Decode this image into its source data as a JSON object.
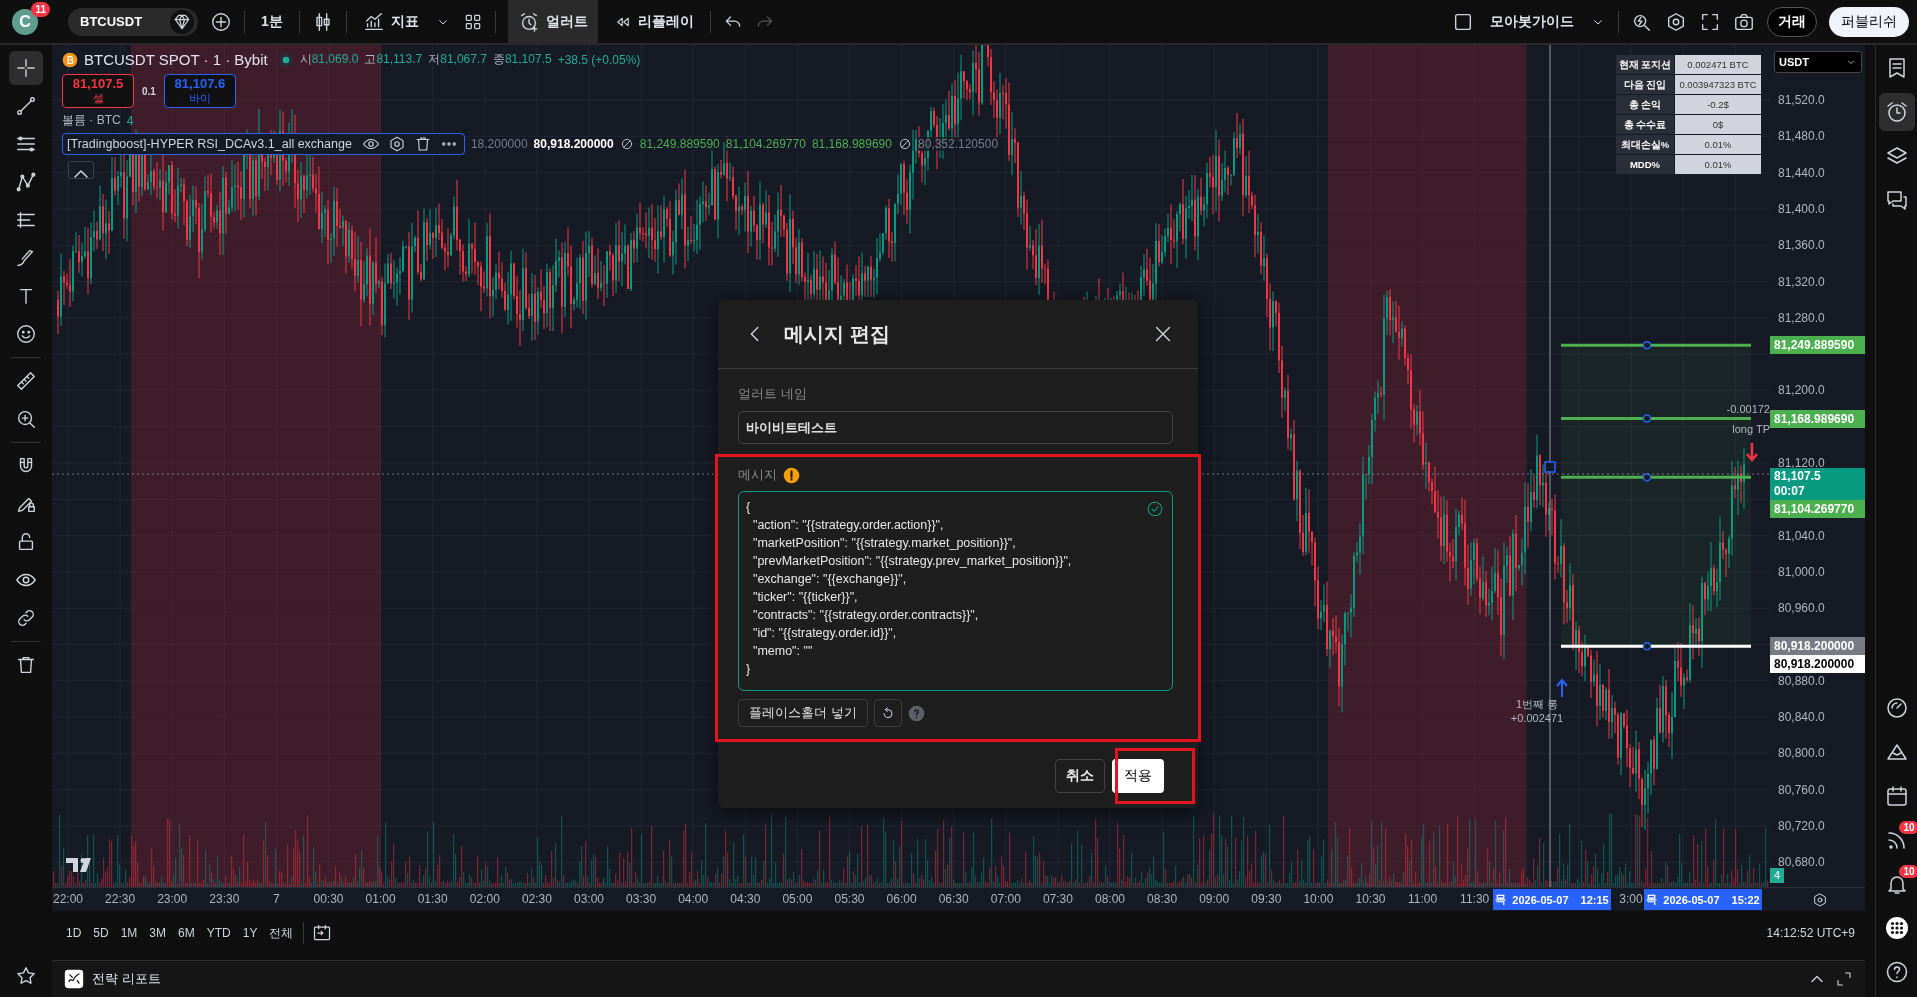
{
  "top_bar": {
    "avatar": "C",
    "avatar_badge": "11",
    "symbol": "BTCUSDT",
    "interval": "1분",
    "indicators": "지표",
    "alert": {
      "label": "얼러트",
      "selected": true
    },
    "replay": "리플레이",
    "layout_name": "모아봇가이드",
    "trade": "거래",
    "publish": "퍼블리쉬"
  },
  "left_toolbar": [
    {
      "kind": "crosshair",
      "selected": true
    },
    {
      "kind": "trendline",
      "selected": false
    },
    {
      "kind": "lines",
      "selected": false
    },
    {
      "kind": "pattern",
      "selected": false
    },
    {
      "kind": "fib",
      "selected": false
    },
    {
      "kind": "brush",
      "selected": false
    },
    {
      "kind": "text",
      "selected": false
    },
    {
      "kind": "emoji",
      "selected": false
    },
    {
      "kind": "ruler",
      "selected": false
    },
    {
      "kind": "zoom",
      "selected": false
    },
    {
      "kind": "magnet",
      "selected": false
    },
    {
      "kind": "pencil-lock",
      "selected": false
    },
    {
      "kind": "lock",
      "selected": false
    },
    {
      "kind": "eye",
      "selected": false
    },
    {
      "kind": "link",
      "selected": false
    },
    {
      "kind": "trash",
      "selected": false
    },
    {
      "kind": "star",
      "selected": false
    }
  ],
  "legend": {
    "title": "BTCUSDT SPOT · 1 · Bybit",
    "ohlc": [
      {
        "label": "시",
        "value": "81,069.0"
      },
      {
        "label": "고",
        "value": "81,113.7"
      },
      {
        "label": "저",
        "value": "81,067.7"
      },
      {
        "label": "종",
        "value": "81,107.5"
      }
    ],
    "change": "+38.5 (+0.05%)",
    "sell_price": "81,107.5",
    "sell_label": "셀",
    "spread": "0.1",
    "buy_price": "81,107.6",
    "buy_label": "바이",
    "volume_label": "볼륨 · BTC",
    "volume_value": "4",
    "strategy_name": "[Tradingboost]-HYPER RSI_DCAv3.1_all exchange",
    "strategy_values": [
      {
        "kind": "value",
        "text": "18.200000",
        "color": "#787b86"
      },
      {
        "kind": "value",
        "text": "80,918.200000",
        "color": "#ffffff"
      },
      {
        "kind": "na"
      },
      {
        "kind": "value",
        "text": "81,249.889590",
        "color": "#4caf50"
      },
      {
        "kind": "value",
        "text": "81,104.269770",
        "color": "#4caf50"
      },
      {
        "kind": "value",
        "text": "81,168.989690",
        "color": "#4caf50"
      },
      {
        "kind": "na"
      },
      {
        "kind": "value",
        "text": "80,352.120500",
        "color": "#787b86"
      }
    ]
  },
  "strategy_table": [
    {
      "label": "현재 포지션",
      "value": "0.002471 BTC"
    },
    {
      "label": "다음 진입",
      "value": "0.003947323 BTC"
    },
    {
      "label": "총 손익",
      "value": "-0.2$"
    },
    {
      "label": "총 수수료",
      "value": "0$"
    },
    {
      "label": "최대손실%",
      "value": "0.01%"
    },
    {
      "label": "MDD%",
      "value": "0.01%"
    }
  ],
  "chart_annotations": [
    {
      "text": "-0.00172"
    },
    {
      "text": "long TP"
    },
    {
      "text": "1번째 롱"
    },
    {
      "text": "+0.002471"
    }
  ],
  "price_axis": {
    "currency": "USDT",
    "ticks": [
      "81,520.0",
      "81,480.0",
      "81,440.0",
      "81,400.0",
      "81,360.0",
      "81,320.0",
      "81,280.0",
      "81,200.0",
      "81,120.0",
      "81,040.0",
      "81,000.0",
      "80,960.0",
      "80,880.0",
      "80,840.0",
      "80,800.0",
      "80,760.0",
      "80,720.0",
      "80,680.0"
    ],
    "labels": [
      {
        "kind": "line",
        "text": "81,249.889590",
        "color": "#4caf50"
      },
      {
        "kind": "line",
        "text": "81,168.989690",
        "color": "#4caf50"
      },
      {
        "kind": "last",
        "text": "81,107.5",
        "countdown": "00:07",
        "color": "#089981"
      },
      {
        "kind": "line",
        "text": "81,104.269770",
        "color": "#4caf50"
      },
      {
        "kind": "line",
        "text": "80,918.200000",
        "color": "#787b86"
      },
      {
        "kind": "line",
        "text": "80,918.200000",
        "color": "#ffffff"
      }
    ],
    "volume_label": "4"
  },
  "time_axis": {
    "labels": [
      "22:00",
      "22:30",
      "23:00",
      "23:30",
      "7",
      "00:30",
      "01:00",
      "01:30",
      "02:00",
      "02:30",
      "03:00",
      "03:30",
      "04:00",
      "04:30",
      "05:00",
      "05:30",
      "06:00",
      "06:30",
      "07:00",
      "07:30",
      "08:00",
      "08:30",
      "09:00",
      "09:30",
      "10:00",
      "10:30",
      "11:00",
      "11:30",
      "3:00"
    ],
    "cursor_labels": [
      {
        "day": "목",
        "date": "2026-05-07",
        "time": "12:15"
      },
      {
        "day": "목",
        "date": "2026-05-07",
        "time": "15:22"
      }
    ]
  },
  "range_bar": {
    "ranges": [
      "1D",
      "5D",
      "1M",
      "3M",
      "6M",
      "YTD",
      "1Y",
      "전체"
    ],
    "clock": "14:12:52 UTC+9"
  },
  "bottom_panel": {
    "title": "전략 리포트"
  },
  "right_sidebar": [
    {
      "kind": "watchlist",
      "selected": false
    },
    {
      "kind": "alerts",
      "selected": true
    },
    {
      "kind": "layers",
      "selected": false
    },
    {
      "kind": "chat",
      "selected": false
    },
    {
      "kind": "gauge",
      "selected": false
    },
    {
      "kind": "mountain",
      "selected": false
    },
    {
      "kind": "calendar",
      "selected": false
    },
    {
      "kind": "signal",
      "selected": false,
      "badge": "10"
    },
    {
      "kind": "bell",
      "selected": false,
      "badge": "10"
    },
    {
      "kind": "apps",
      "selected": false
    },
    {
      "kind": "help",
      "selected": false
    }
  ],
  "dialog": {
    "title": "메시지 편집",
    "name_label": "얼러트 네임",
    "name_value": "바이비트테스트",
    "message_label": "메시지",
    "message": "{\n  \"action\": \"{{strategy.order.action}}\",\n  \"marketPosition\": \"{{strategy.market_position}}\",\n  \"prevMarketPosition\": \"{{strategy.prev_market_position}}\",\n  \"exchange\": \"{{exchange}}\",\n  \"ticker\": \"{{ticker}}\",\n  \"contracts\": \"{{strategy.order.contracts}}\",\n  \"id\": \"{{strategy.order.id}}\",\n  \"memo\": \"\"\n}",
    "placeholder_button": "플레이스홀더 넣기",
    "cancel": "취소",
    "apply": "적용"
  }
}
